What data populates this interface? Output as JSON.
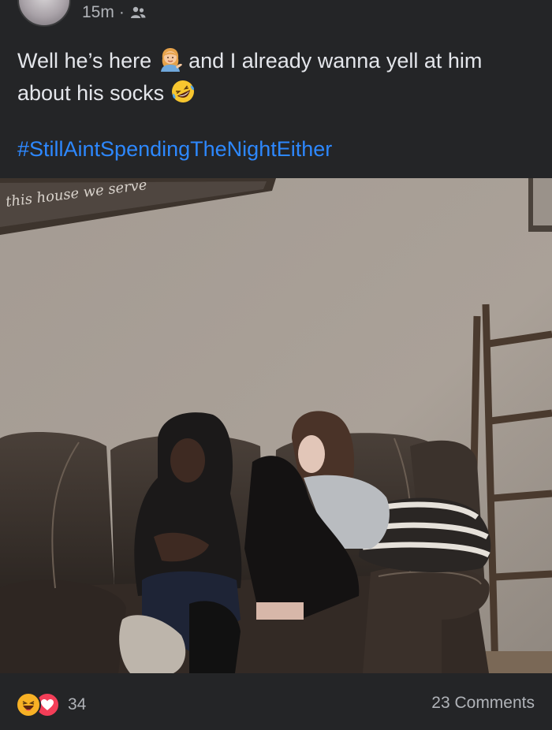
{
  "post": {
    "time": "15m",
    "separator": "·",
    "audience_icon": "friends-icon",
    "text_part1": "Well he’s here",
    "emoji1": "woman-tipping-hand",
    "text_part2": "and I already wanna yell at him about his socks",
    "emoji2": "rolling-on-floor-laughing",
    "hashtag": "#StillAintSpendingTheNightEither",
    "photo_sign_text": "this house we serve"
  },
  "footer": {
    "reaction_icons": [
      "haha-reaction-icon",
      "love-reaction-icon"
    ],
    "reaction_count": "34",
    "comments_label": "23 Comments"
  },
  "colors": {
    "background": "#242527",
    "text": "#e4e6eb",
    "muted": "#b0b3b8",
    "hashtag": "#2d88ff",
    "haha": "#f7b125",
    "love": "#f33e58"
  }
}
